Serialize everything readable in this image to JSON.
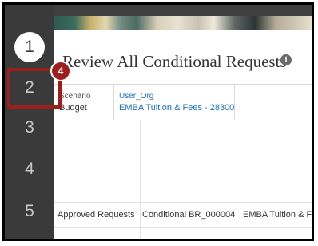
{
  "steps": [
    "1",
    "2",
    "3",
    "4",
    "5"
  ],
  "page": {
    "title": "Review All Conditional Requests",
    "info_icon": "i"
  },
  "filters": [
    {
      "label": "Scenario",
      "value": "Budget"
    },
    {
      "label": "User_Org",
      "value": "EMBA Tuition & Fees - 28300"
    }
  ],
  "row": {
    "col1": "Approved Requests",
    "col2": "Conditional BR_000004",
    "col3": "EMBA Tuition & Fees"
  },
  "callout": {
    "number": "4"
  },
  "colors": {
    "callout": "#9b1f1f",
    "link": "#1f6fb2",
    "rail": "#3b3a3a"
  }
}
